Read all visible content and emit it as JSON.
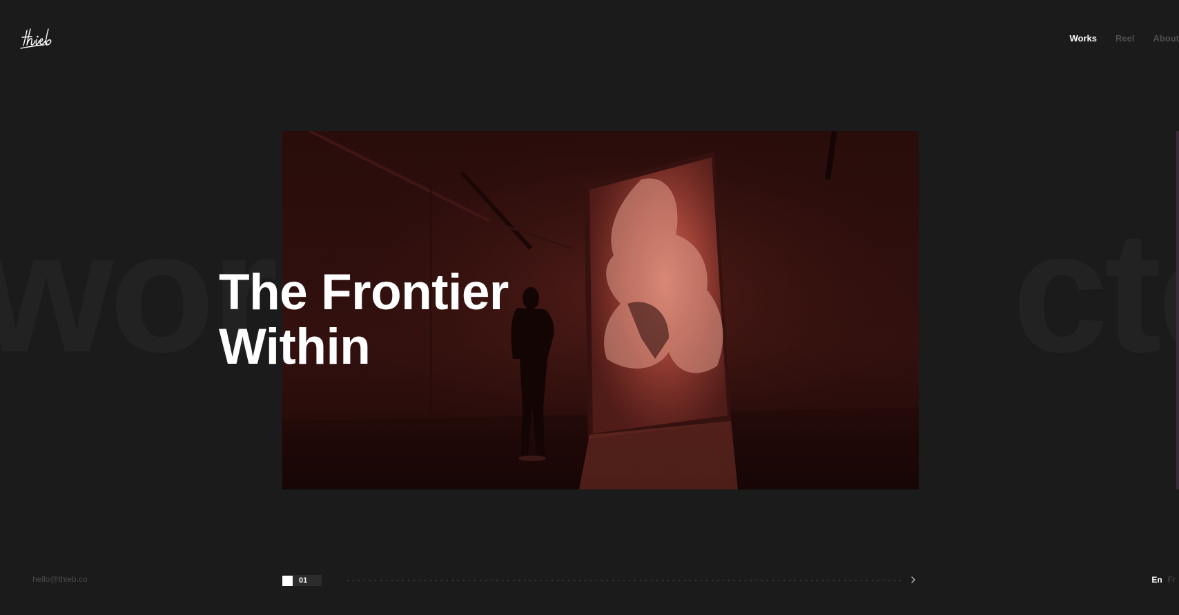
{
  "brand": {
    "logo_text": "thieb"
  },
  "nav": {
    "items": [
      {
        "label": "Works",
        "active": true
      },
      {
        "label": "Reel",
        "active": false
      },
      {
        "label": "About",
        "active": false
      }
    ]
  },
  "background_words": {
    "left": "world",
    "right": "cted"
  },
  "hero": {
    "title_line1": "The Frontier",
    "title_line2": "Within"
  },
  "footer": {
    "email": "hello@thieb.co",
    "slide_number": "01",
    "next_icon": "chevron-right-icon",
    "languages": [
      {
        "label": "En",
        "active": true
      },
      {
        "label": "Fr",
        "active": false
      }
    ]
  },
  "colors": {
    "background": "#1b1b1b",
    "text_primary": "#ffffff",
    "text_dim": "#4e4e4e",
    "media_tint": "#c8483c"
  }
}
